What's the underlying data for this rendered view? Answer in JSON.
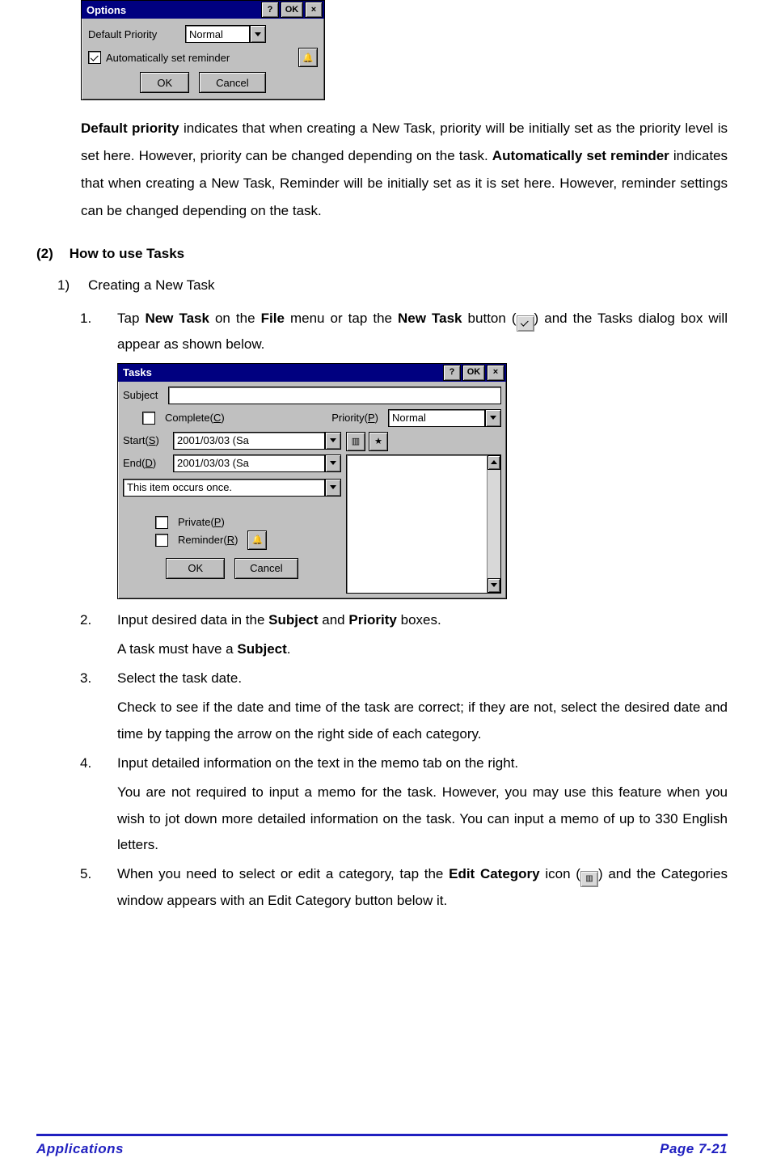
{
  "options_dialog": {
    "title": "Options",
    "help_label": "?",
    "ok_label": "OK",
    "close_label": "×",
    "default_priority_label": "Default Priority",
    "default_priority_value": "Normal",
    "auto_reminder_label": "Automatically set reminder",
    "auto_reminder_checked": true,
    "ok_button": "OK",
    "cancel_button": "Cancel"
  },
  "para1": {
    "p1a": "Default priority",
    "p1b": " indicates that when creating a New Task, priority will be initially set as the priority level is set here. However, priority can be changed depending on the task. ",
    "p1c": "Automatically set reminder",
    "p1d": " indicates that when creating a New Task, Reminder will be initially set as it is set here. However, reminder settings can be changed depending on the task."
  },
  "section2": {
    "num": "(2)",
    "title": "How to use Tasks",
    "item1_num": "1)",
    "item1_label": "Creating a New Task",
    "step1_num": "1.",
    "step1a": "Tap ",
    "step1b": "New Task",
    "step1c": " on the ",
    "step1d": "File",
    "step1e": " menu or tap the ",
    "step1f": "New Task",
    "step1g": " button (",
    "step1h": ") and the Tasks dialog box will appear as shown below.",
    "step2_num": "2.",
    "step2a": "Input desired data in the ",
    "step2b": "Subject",
    "step2c": " and ",
    "step2d": "Priority",
    "step2e": " boxes.",
    "step2_after_a": "A task must have a ",
    "step2_after_b": "Subject",
    "step2_after_c": ".",
    "step3_num": "3.",
    "step3": "Select the task date.",
    "step3_after": "Check to see if the date and time of the task are correct; if they are not, select the desired date and time by tapping the arrow on the right side of each category.",
    "step4_num": "4.",
    "step4": "Input detailed information on the text in the memo tab on the right.",
    "step4_after": "You are not required to input a memo for the task. However, you may use this feature when you wish to jot down more detailed information on the task. You can input a memo of up to 330 English letters.",
    "step5_num": "5.",
    "step5a": "When you need to select or edit a category, tap the ",
    "step5b": "Edit Category",
    "step5c": " icon (",
    "step5d": ") and the Categories window appears with an Edit Category button below it."
  },
  "tasks_dialog": {
    "title": "Tasks",
    "help_label": "?",
    "ok_label": "OK",
    "close_label": "×",
    "subject_label": "Subject",
    "subject_value": "",
    "complete_label_pre": "Complete(",
    "complete_label_u": "C",
    "complete_label_post": ")",
    "priority_label_pre": "Priority(",
    "priority_label_u": "P",
    "priority_label_post": ")",
    "priority_value": "Normal",
    "start_label_pre": "Start(",
    "start_label_u": "S",
    "start_label_post": ")",
    "start_value": "2001/03/03 (Sa",
    "end_label_pre": "End(",
    "end_label_u": "D",
    "end_label_post": ")",
    "end_value": "2001/03/03 (Sa",
    "recurrence_value": "This item occurs once.",
    "private_label_pre": "Private(",
    "private_label_u": "P",
    "private_label_post": ")",
    "reminder_label_pre": "Reminder(",
    "reminder_label_u": "R",
    "reminder_label_post": ")",
    "ok_button": "OK",
    "cancel_button": "Cancel"
  },
  "footer": {
    "left": "Applications",
    "right": "Page 7-21"
  }
}
